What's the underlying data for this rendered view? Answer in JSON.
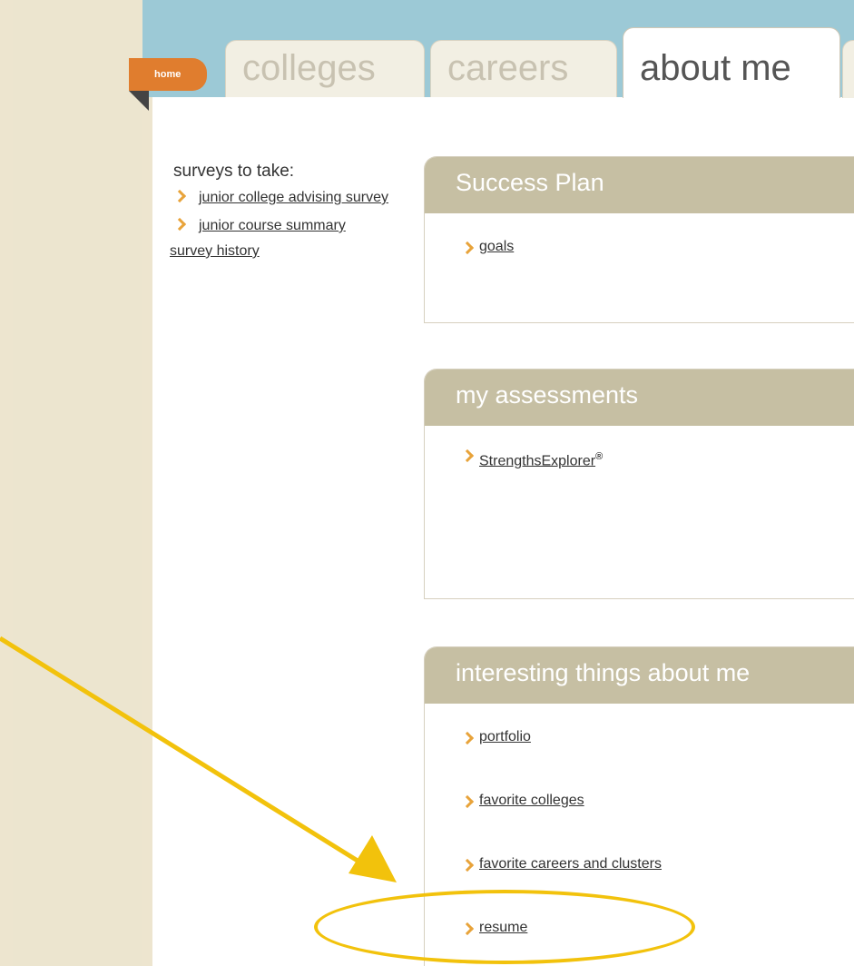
{
  "tabs": {
    "home": "home",
    "colleges": "colleges",
    "careers": "careers",
    "about_me": "about me"
  },
  "sidebar": {
    "heading": "surveys to take:",
    "items": [
      {
        "label": "junior college advising survey"
      },
      {
        "label": "junior course summary"
      }
    ],
    "history_link": "survey history"
  },
  "panels": {
    "success_plan": {
      "title": "Success Plan",
      "items": [
        {
          "label": "goals"
        }
      ]
    },
    "assessments": {
      "title": "my assessments",
      "items": [
        {
          "label": "StrengthsExplorer",
          "mark": "®"
        }
      ]
    },
    "interesting": {
      "title": "interesting things about me",
      "items": [
        {
          "label": "portfolio"
        },
        {
          "label": "favorite colleges"
        },
        {
          "label": "favorite careers and clusters"
        },
        {
          "label": "resume"
        }
      ]
    }
  },
  "annotation": {
    "color": "#f2c20c",
    "target": "resume"
  },
  "colors": {
    "slide_bg": "#0d2a8f",
    "home_tab": "#e07d2e",
    "panel_header": "#c6bfa3",
    "chevron": "#e8a33a",
    "sky": "#9cc9d6"
  }
}
